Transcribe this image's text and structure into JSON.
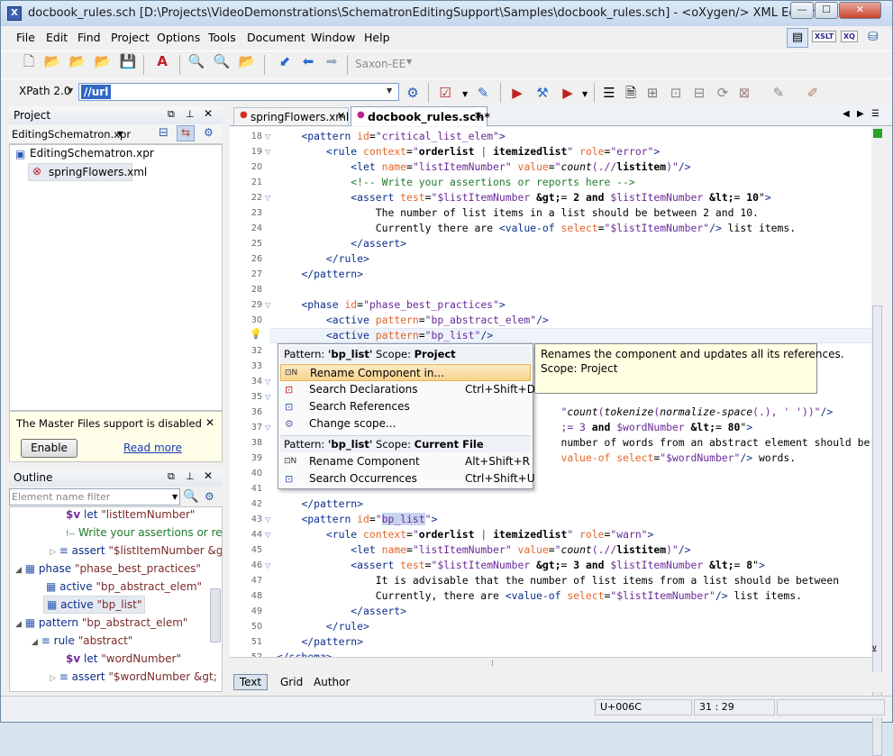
{
  "window": {
    "title": "docbook_rules.sch [D:\\Projects\\VideoDemonstrations\\SchematronEditingSupport\\Samples\\docbook_rules.sch] - <oXygen/> XML Editor",
    "min": "—",
    "max": "☐",
    "close": "✕"
  },
  "menu": [
    "File",
    "Edit",
    "Find",
    "Project",
    "Options",
    "Tools",
    "Document",
    "Window",
    "Help"
  ],
  "perspective": {
    "xslt": "XSLT",
    "xq": "XQ"
  },
  "toolbar": {
    "engine": "Saxon-EE"
  },
  "xpath": {
    "version": "XPath 2.0",
    "value": "//url"
  },
  "project": {
    "title": "Project",
    "file": "EditingSchematron.xpr",
    "root": "EditingSchematron.xpr",
    "child": "springFlowers.xml",
    "master_msg": "The Master Files support is disabled",
    "enable": "Enable",
    "read_more": "Read more"
  },
  "outline": {
    "title": "Outline",
    "filter_placeholder": "Element name filter",
    "rows": [
      {
        "kind": "$v",
        "name": "let",
        "attr": "\"listItemNumber\""
      },
      {
        "kind": "!--",
        "name": "",
        "attr": "Write your assertions or re"
      },
      {
        "kind": "≡",
        "name": "assert",
        "attr": "\"$listItemNumber &gt"
      },
      {
        "kind": "▦",
        "name": "phase",
        "attr": "\"phase_best_practices\""
      },
      {
        "kind": "▦",
        "name": "active",
        "attr": "\"bp_abstract_elem\""
      },
      {
        "kind": "▦",
        "name": "active",
        "attr": "\"bp_list\""
      },
      {
        "kind": "▦",
        "name": "pattern",
        "attr": "\"bp_abstract_elem\""
      },
      {
        "kind": "≡",
        "name": "rule",
        "attr": "\"abstract\""
      },
      {
        "kind": "$v",
        "name": "let",
        "attr": "\"wordNumber\""
      },
      {
        "kind": "≡",
        "name": "assert",
        "attr": "\"$wordNumber &gt;"
      }
    ]
  },
  "tabs": [
    {
      "label": "springFlowers.xml"
    },
    {
      "label": "docbook_rules.sch*"
    }
  ],
  "line_numbers": [
    "18",
    "19",
    "20",
    "21",
    "22",
    "23",
    "24",
    "25",
    "26",
    "27",
    "28",
    "29",
    "30",
    "31",
    "32",
    "33",
    "34",
    "35",
    "36",
    "37",
    "38",
    "39",
    "40",
    "41",
    "42",
    "43",
    "44",
    "45",
    "46",
    "47",
    "48",
    "49",
    "50",
    "51",
    "52"
  ],
  "popup": {
    "header1_label": "Pattern: ",
    "header1_name": "'bp_list'",
    "header1_scope": "  Scope: ",
    "header1_scope_val": "Project",
    "items1": [
      {
        "label": "Rename Component in...",
        "shortcut": ""
      },
      {
        "label": "Search Declarations",
        "shortcut": "Ctrl+Shift+D"
      },
      {
        "label": "Search References",
        "shortcut": ""
      },
      {
        "label": "Change scope...",
        "shortcut": ""
      }
    ],
    "header2_label": "Pattern: ",
    "header2_name": "'bp_list'",
    "header2_scope": "  Scope: ",
    "header2_scope_val": "Current File",
    "items2": [
      {
        "label": "Rename Component",
        "shortcut": "Alt+Shift+R"
      },
      {
        "label": "Search Occurrences",
        "shortcut": "Ctrl+Shift+U"
      }
    ]
  },
  "tooltip": {
    "line1": "Renames the component and updates all its references.",
    "line2": "Scope: Project"
  },
  "bottom_tabs": [
    "Text",
    "Grid",
    "Author"
  ],
  "status": {
    "unicode": "U+006C",
    "position": "31 : 29"
  }
}
